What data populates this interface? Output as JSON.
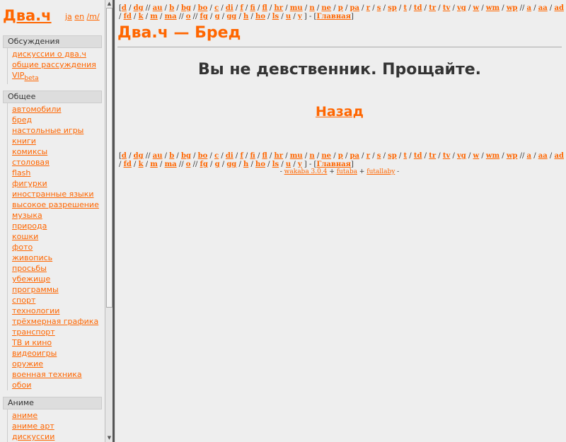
{
  "sidebar": {
    "logo": "Два.ч",
    "lang_links": [
      "ja",
      "en",
      "/m/"
    ],
    "sections": [
      {
        "title": "Обсуждения",
        "items": [
          "дискуссии о два.ч",
          "общие рассуждения",
          "VIP"
        ],
        "vip_sub": "beta"
      },
      {
        "title": "Общее",
        "items": [
          "автомобили",
          "бред",
          "настольные игры",
          "книги",
          "комиксы",
          "столовая",
          "flash",
          "фигурки",
          "иностранные языки",
          "высокое разрешение",
          "музыка",
          "природа",
          "кошки",
          "фото",
          "живопись",
          "просьбы",
          "убежище",
          "программы",
          "спорт",
          "технологии",
          "трёхмерная графика",
          "транспорт",
          "ТВ и кино",
          "видеоигры",
          "оружие",
          "военная техника",
          "обои"
        ]
      },
      {
        "title": "Аниме",
        "items": [
          "аниме",
          "аниме арт",
          "дискуссии"
        ]
      }
    ]
  },
  "nav": {
    "groups": [
      [
        "d",
        "dg"
      ],
      [
        "au",
        "b",
        "bg",
        "bo",
        "c",
        "di",
        "f",
        "fi",
        "fl",
        "hr",
        "mu",
        "n",
        "ne",
        "p",
        "pa",
        "r",
        "s",
        "sp",
        "t",
        "td",
        "tr",
        "tv",
        "vg",
        "w",
        "wm",
        "wp"
      ],
      [
        "a",
        "aa",
        "ad",
        "fd",
        "k",
        "m",
        "ma"
      ],
      [
        "o"
      ],
      [
        "fg",
        "g",
        "gg",
        "h",
        "ho",
        "ls",
        "u",
        "y"
      ]
    ],
    "home": "Главная"
  },
  "main": {
    "title": "Два.ч — Бред",
    "message": "Вы не девственник. Прощайте.",
    "back": "Назад"
  },
  "footer": {
    "links": [
      "wakaba 3.0.4",
      "futaba",
      "futallaby"
    ]
  },
  "colors": {
    "accent": "#ff6600",
    "background": "#eeeeee"
  }
}
